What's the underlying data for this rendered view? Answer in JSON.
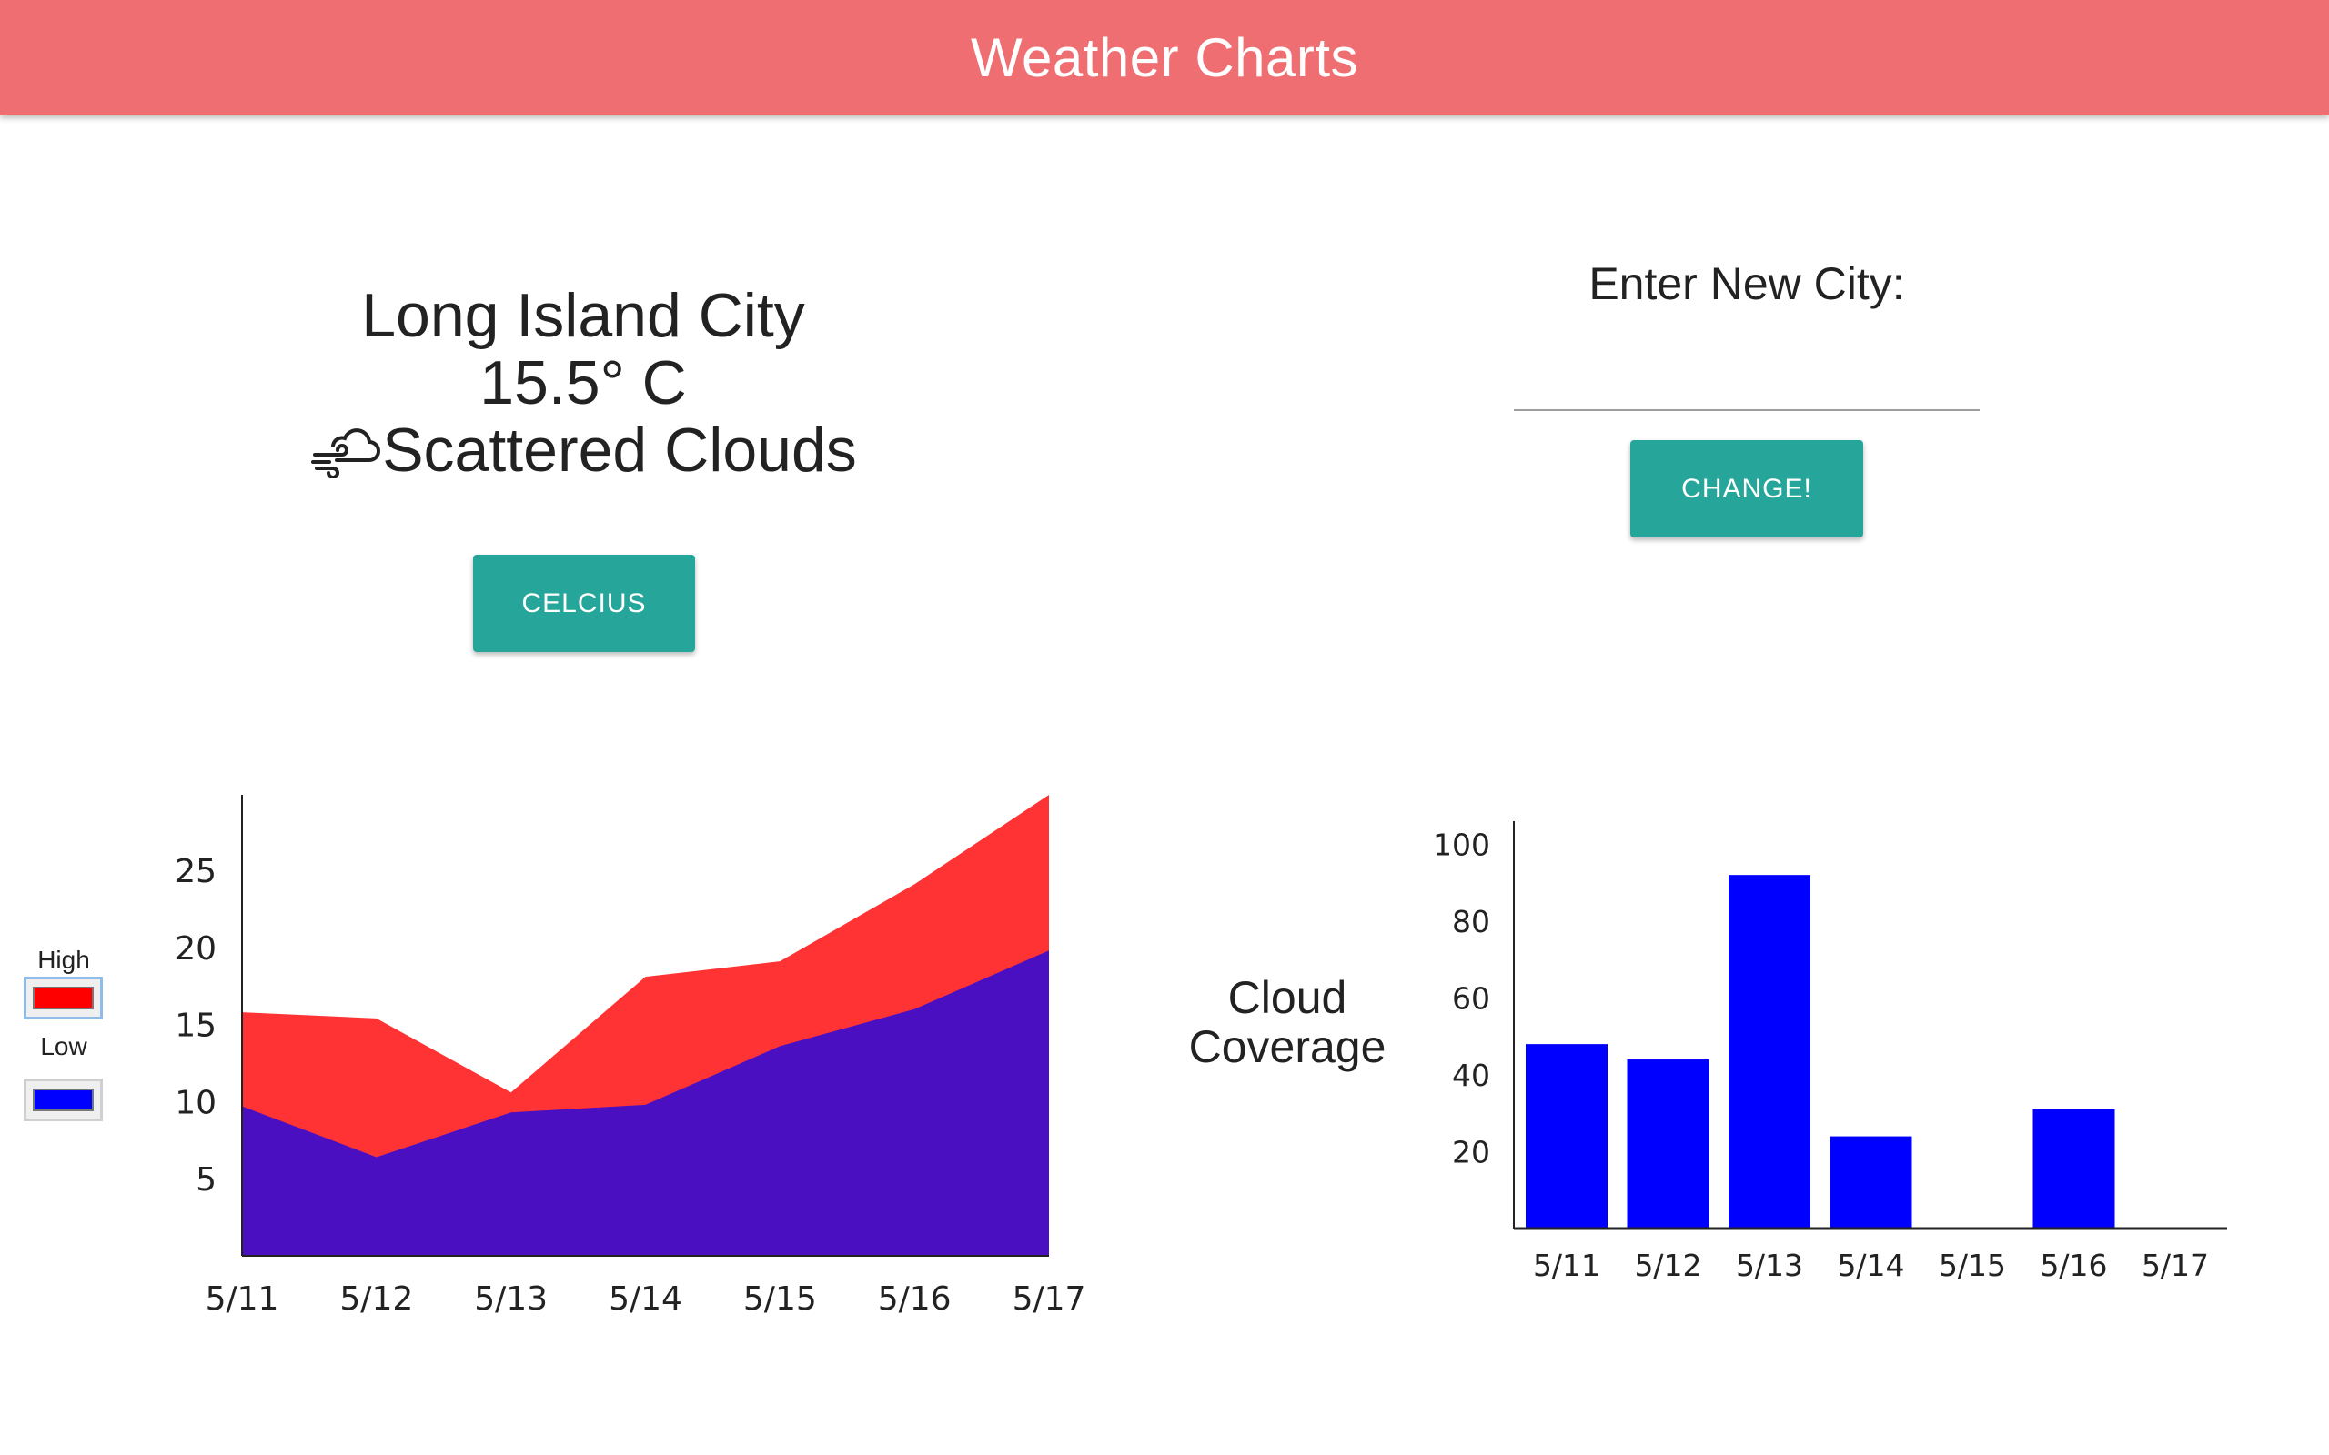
{
  "header": {
    "title": "Weather Charts"
  },
  "current": {
    "city": "Long Island City",
    "temperature": "15.5° C",
    "condition_icon": "cloud-wind-icon",
    "condition": "Scattered Clouds",
    "unit_button": "CELCIUS"
  },
  "city_form": {
    "label": "Enter New City:",
    "input_value": "",
    "input_placeholder": "",
    "submit_label": "CHANGE!"
  },
  "legend": {
    "items": [
      {
        "label": "High",
        "color": "#ff0000"
      },
      {
        "label": "Low",
        "color": "#0000ff"
      }
    ]
  },
  "cloud_chart_label": {
    "line1": "Cloud",
    "line2": "Coverage"
  },
  "colors": {
    "header": "#ef6e72",
    "button": "#26a69a",
    "high_area": "#ff3333",
    "low_area": "#4b0fc2",
    "bar": "#0000ff"
  },
  "chart_data": [
    {
      "type": "area",
      "title": "",
      "xlabel": "",
      "ylabel": "",
      "categories": [
        "5/11",
        "5/12",
        "5/13",
        "5/14",
        "5/15",
        "5/16",
        "5/17"
      ],
      "series": [
        {
          "name": "High",
          "values": [
            15.8,
            15.4,
            10.6,
            18.1,
            19.1,
            24.1,
            29.9
          ]
        },
        {
          "name": "Low",
          "values": [
            9.7,
            6.4,
            9.3,
            9.8,
            13.6,
            16.0,
            19.8
          ]
        }
      ],
      "yticks": [
        5,
        10,
        15,
        20,
        25
      ],
      "ylim": [
        0,
        29.9
      ],
      "grid": false,
      "legend": "left"
    },
    {
      "type": "bar",
      "title": "",
      "xlabel": "",
      "ylabel": "Cloud Coverage",
      "categories": [
        "5/11",
        "5/12",
        "5/13",
        "5/14",
        "5/15",
        "5/16",
        "5/17"
      ],
      "values": [
        48,
        44,
        92,
        24,
        0,
        31,
        0
      ],
      "yticks": [
        20,
        40,
        60,
        80,
        100
      ],
      "ylim": [
        0,
        106
      ],
      "grid": false
    }
  ]
}
